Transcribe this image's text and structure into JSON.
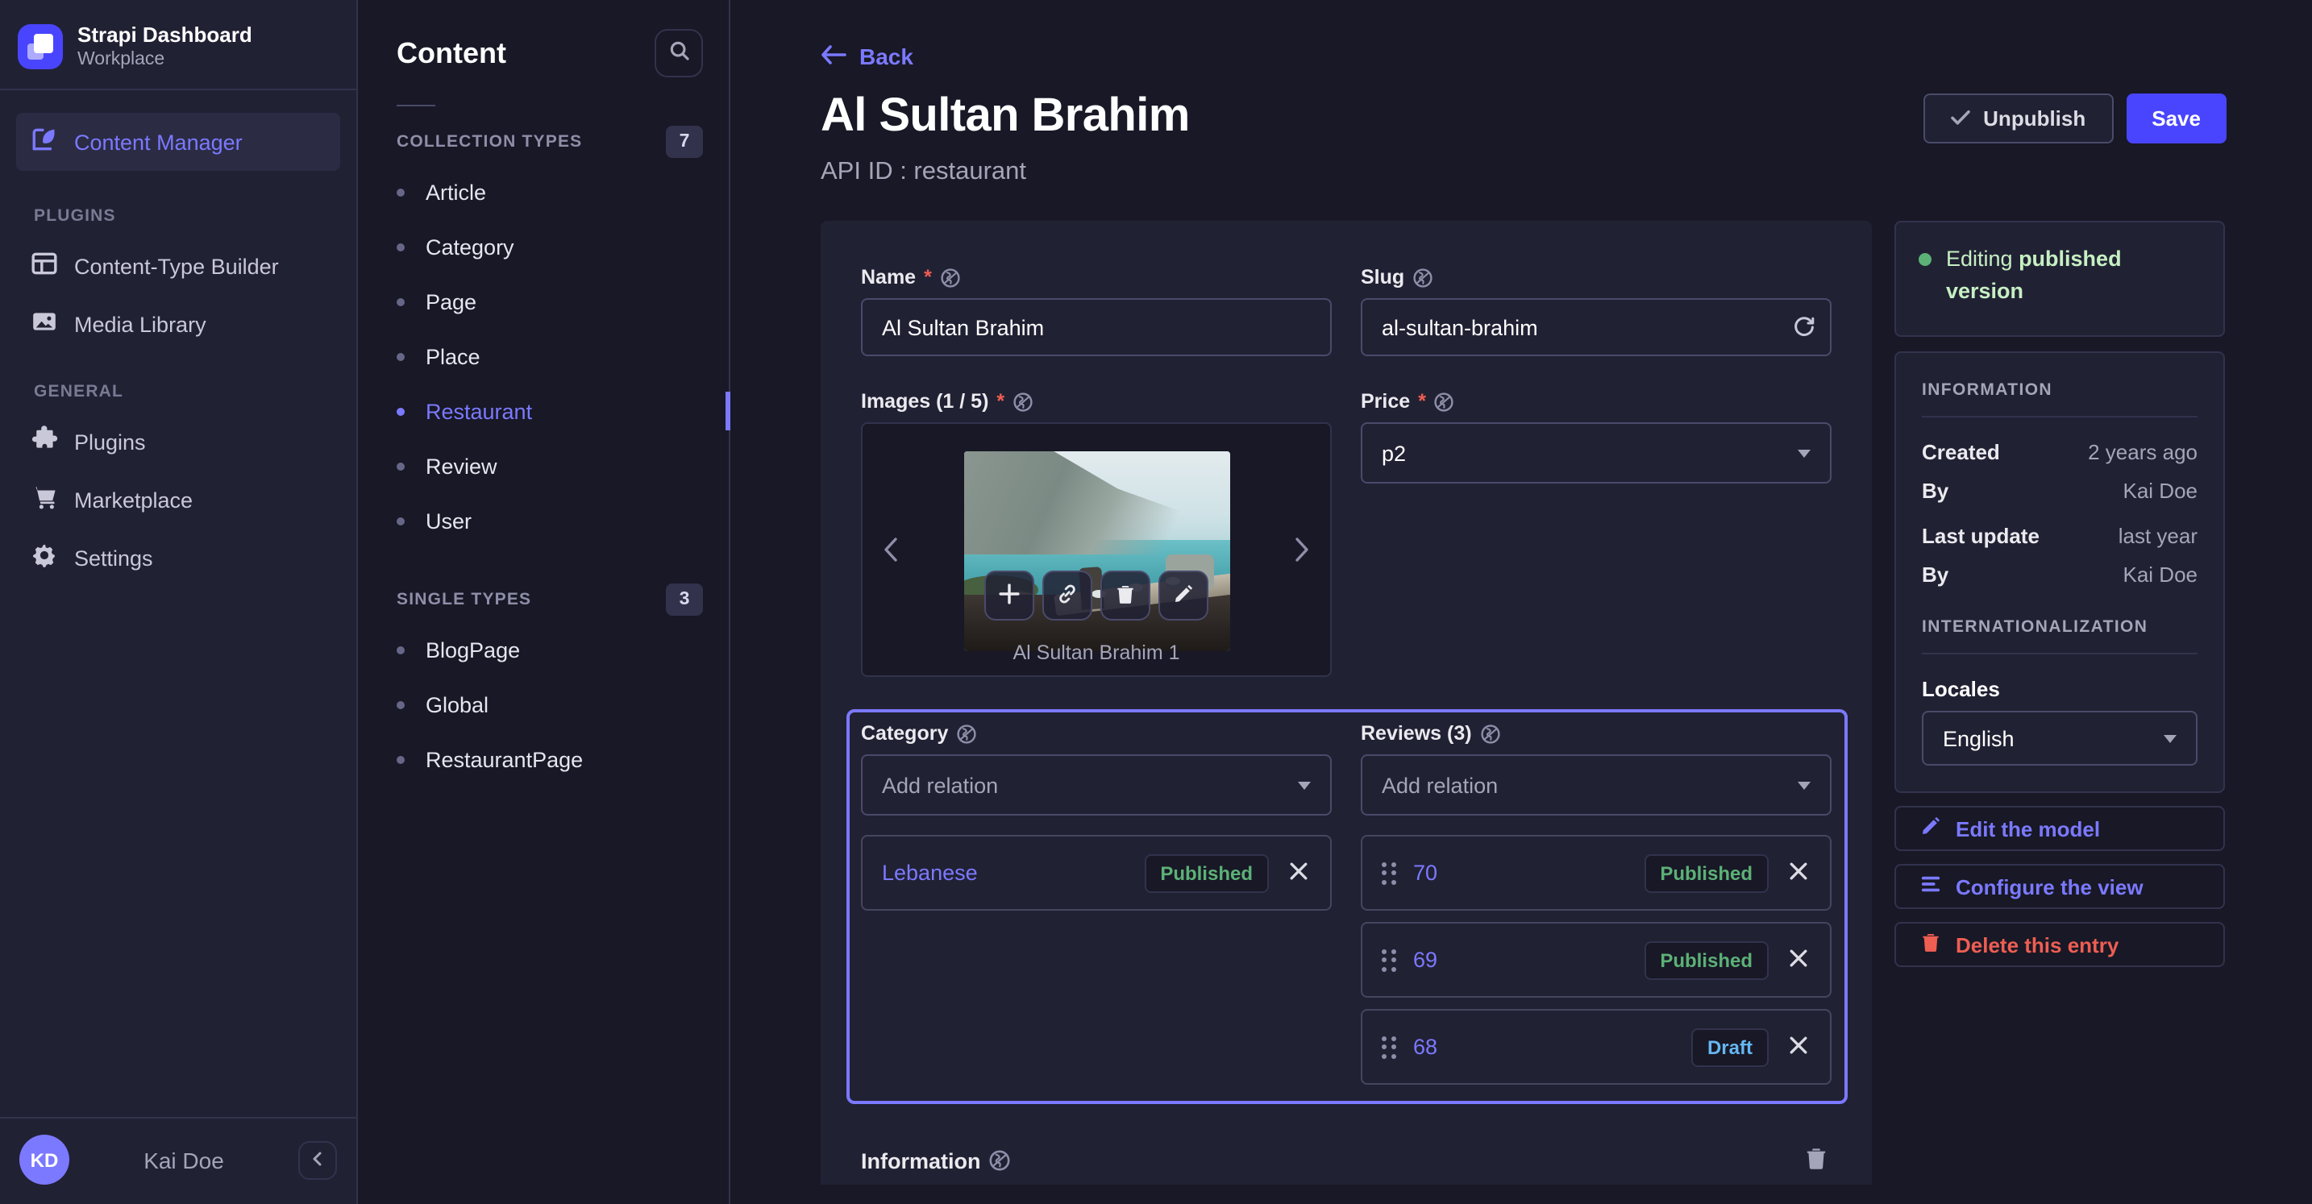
{
  "colors": {
    "primary": "#4945ff",
    "accent": "#7b79ff",
    "success": "#5cb176",
    "success_light": "#c6f0c2",
    "danger": "#ee5e52",
    "draft_blue": "#66b7f1",
    "bg": "#181826",
    "surface": "#212134"
  },
  "nav": {
    "brand": {
      "title": "Strapi Dashboard",
      "subtitle": "Workplace"
    },
    "content_manager": {
      "label": "Content Manager",
      "icon": "feather-edit-icon"
    },
    "plugins_section": "PLUGINS",
    "general_section": "GENERAL",
    "items": [
      {
        "label": "Content-Type Builder",
        "icon": "layout-grid-icon"
      },
      {
        "label": "Media Library",
        "icon": "picture-icon"
      },
      {
        "label": "Plugins",
        "icon": "puzzle-icon"
      },
      {
        "label": "Marketplace",
        "icon": "cart-icon"
      },
      {
        "label": "Settings",
        "icon": "gear-icon"
      }
    ],
    "user": {
      "initials": "KD",
      "name": "Kai Doe"
    }
  },
  "subnav": {
    "title": "Content",
    "search_icon": "magnifier-icon",
    "collection": {
      "label": "COLLECTION TYPES",
      "count": "7",
      "items": [
        {
          "label": "Article"
        },
        {
          "label": "Category"
        },
        {
          "label": "Page"
        },
        {
          "label": "Place"
        },
        {
          "label": "Restaurant",
          "active": true
        },
        {
          "label": "Review"
        },
        {
          "label": "User"
        }
      ]
    },
    "single": {
      "label": "SINGLE TYPES",
      "count": "3",
      "items": [
        {
          "label": "BlogPage"
        },
        {
          "label": "Global"
        },
        {
          "label": "RestaurantPage"
        }
      ]
    }
  },
  "header": {
    "back": "Back",
    "title": "Al Sultan Brahim",
    "subtitle": "API ID : restaurant",
    "unpublish_label": "Unpublish",
    "save_label": "Save"
  },
  "form": {
    "name": {
      "label": "Name",
      "required": "*",
      "value": "Al Sultan Brahim"
    },
    "slug": {
      "label": "Slug",
      "value": "al-sultan-brahim"
    },
    "images": {
      "label": "Images (1 / 5)",
      "required": "*",
      "caption": "Al Sultan Brahim 1"
    },
    "price": {
      "label": "Price",
      "required": "*",
      "value": "p2"
    },
    "category": {
      "label": "Category",
      "placeholder": "Add relation",
      "items": [
        {
          "name": "Lebanese",
          "status": "Published"
        }
      ]
    },
    "reviews": {
      "label": "Reviews (3)",
      "placeholder": "Add relation",
      "items": [
        {
          "name": "70",
          "status": "Published"
        },
        {
          "name": "69",
          "status": "Published"
        },
        {
          "name": "68",
          "status": "Draft"
        }
      ]
    },
    "component": {
      "label": "Information"
    }
  },
  "aside": {
    "status": {
      "prefix": "Editing ",
      "bold": "published version"
    },
    "information": {
      "title": "INFORMATION",
      "rows": [
        {
          "label": "Created",
          "value": "2 years ago"
        },
        {
          "label": "By",
          "value": "Kai Doe"
        },
        {
          "label": "Last update",
          "value": "last year"
        },
        {
          "label": "By",
          "value": "Kai Doe"
        }
      ]
    },
    "i18n": {
      "title": "INTERNATIONALIZATION",
      "locales_label": "Locales",
      "locale_value": "English"
    },
    "actions": [
      {
        "label": "Edit the model",
        "icon": "pencil-icon"
      },
      {
        "label": "Configure the view",
        "icon": "list-lines-icon"
      },
      {
        "label": "Delete this entry",
        "icon": "trash-icon"
      }
    ]
  }
}
